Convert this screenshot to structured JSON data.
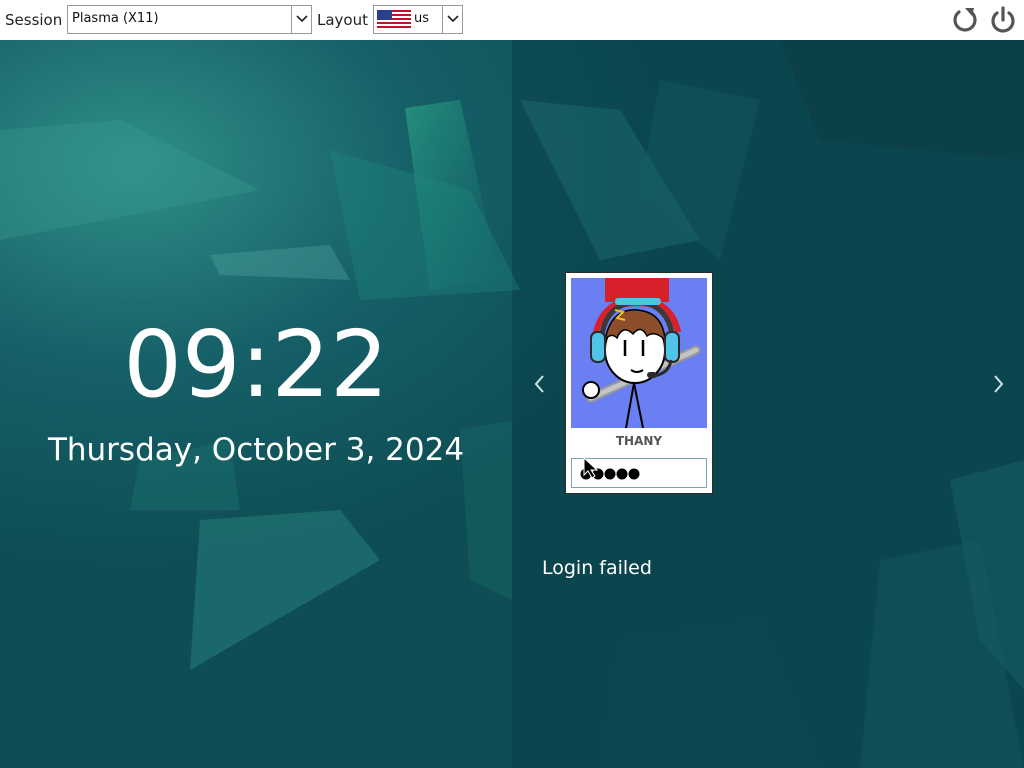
{
  "topbar": {
    "session_label": "Session",
    "session_value": "Plasma (X11)",
    "layout_label": "Layout",
    "layout_value": "us",
    "layout_flag_icon": "us-flag-icon",
    "reboot_icon": "reboot-icon",
    "shutdown_icon": "power-icon"
  },
  "clock": {
    "time": "09:22",
    "date": "Thursday, October 3, 2024"
  },
  "user": {
    "name": "THANY",
    "password_mask": "●●●●●"
  },
  "navigation": {
    "previous_icon": "chevron-left-icon",
    "next_icon": "chevron-right-icon"
  },
  "status": {
    "message": "Login failed"
  },
  "colors": {
    "background": "#0f4f55",
    "accent": "#2fa88a",
    "text": "#ffffff",
    "topbar": "#ffffff"
  }
}
